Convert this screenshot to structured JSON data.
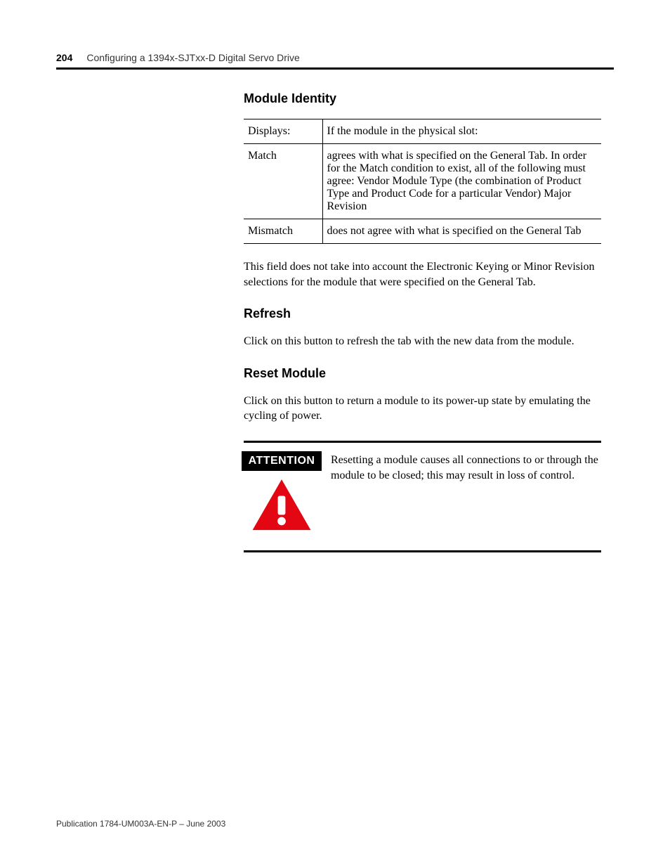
{
  "header": {
    "page_number": "204",
    "title": "Configuring a 1394x-SJTxx-D Digital Servo Drive"
  },
  "sections": {
    "module_identity": {
      "heading": "Module Identity",
      "table": {
        "rows": [
          {
            "c1": "Displays:",
            "c2": "If the module in the physical slot:"
          },
          {
            "c1": "Match",
            "c2": "agrees with what is specified on the General Tab. In order for the Match condition to exist, all of the following must agree: Vendor Module Type (the combination of Product Type and Product Code for a particular Vendor) Major Revision"
          },
          {
            "c1": "Mismatch",
            "c2": "does not agree with what is specified on the General Tab"
          }
        ]
      },
      "note": "This field does not take into account the Electronic Keying or Minor Revision selections for the module that were specified on the General Tab."
    },
    "refresh": {
      "heading": "Refresh",
      "body": "Click on this button to refresh the tab with the new data from the module."
    },
    "reset_module": {
      "heading": "Reset Module",
      "body": "Click on this button to return a module to its power-up state by emulating the cycling of power."
    },
    "attention": {
      "label": "ATTENTION",
      "text": "Resetting a module causes all connections to or through the module to be closed; this may result in loss of control."
    }
  },
  "footer": {
    "publication": "Publication 1784-UM003A-EN-P – June 2003"
  }
}
